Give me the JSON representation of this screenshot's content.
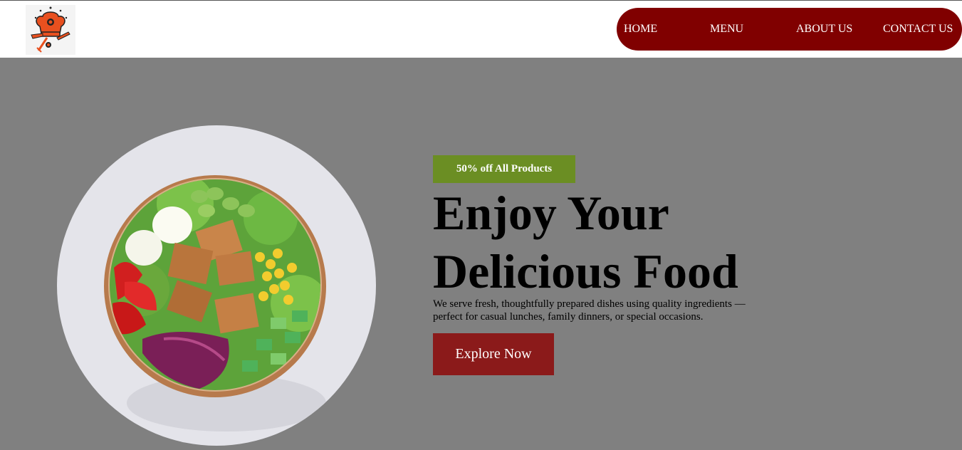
{
  "brand": {
    "logo_icon": "chef-hat-logo-icon"
  },
  "nav": {
    "items": [
      {
        "label": "HOME"
      },
      {
        "label": "MENU"
      },
      {
        "label": "ABOUT US"
      },
      {
        "label": "CONTACT US"
      }
    ]
  },
  "hero": {
    "image_icon": "salad-bowl-image",
    "badge": "50% off All Products",
    "headline_line1": "Enjoy Your",
    "headline_line2": "Delicious Food",
    "description": "We serve fresh, thoughtfully prepared dishes using quality ingredients — perfect for casual lunches, family dinners, or special occasions.",
    "cta_label": "Explore Now"
  },
  "colors": {
    "background": "#808080",
    "nav_bg": "#800000",
    "badge_bg": "#6b8e23",
    "cta_bg": "#8b1a1a",
    "logo_accent": "#e8501f"
  }
}
